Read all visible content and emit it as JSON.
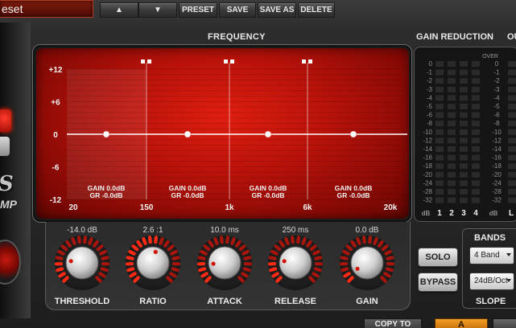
{
  "toolbar": {
    "preset_name": "eset",
    "up_arrow": "▲",
    "down_arrow": "▼",
    "preset_label": "PRESET",
    "save_label": "SAVE",
    "save_as_label": "SAVE AS",
    "delete_label": "DELETE"
  },
  "logo": {
    "letters": "S",
    "sub": "MP"
  },
  "frequency": {
    "title": "FREQUENCY",
    "y_ticks": [
      "+12",
      "+6",
      "0",
      "-6",
      "-12"
    ],
    "x_ticks": [
      "20",
      "150",
      "1k",
      "6k",
      "20k"
    ],
    "bands": [
      {
        "gain_label": "GAIN 0.0dB",
        "gr_label": "GR -0.0dB"
      },
      {
        "gain_label": "GAIN 0.0dB",
        "gr_label": "GR -0.0dB"
      },
      {
        "gain_label": "GAIN 0.0dB",
        "gr_label": "GR -0.0dB"
      },
      {
        "gain_label": "GAIN 0.0dB",
        "gr_label": "GR -0.0dB"
      }
    ]
  },
  "gain_reduction": {
    "title": "GAIN REDUCTION",
    "out_title": "OU",
    "over_label": "OVER",
    "scale": [
      "0",
      "-1",
      "-2",
      "-3",
      "-4",
      "-5",
      "-6",
      "-8",
      "-10",
      "-12",
      "-14",
      "-16",
      "-18",
      "-20",
      "-24",
      "-28",
      "-32"
    ],
    "channels": [
      "dB",
      "1",
      "2",
      "3",
      "4",
      "dB",
      "L"
    ]
  },
  "knobs": [
    {
      "value": "-14.0 dB",
      "label": "THRESHOLD",
      "level": 0.2
    },
    {
      "value": "2.6 :1",
      "label": "RATIO",
      "level": 0.55
    },
    {
      "value": "10.0 ms",
      "label": "ATTACK",
      "level": 0.15
    },
    {
      "value": "250 ms",
      "label": "RELEASE",
      "level": 0.2
    },
    {
      "value": "0.0 dB",
      "label": "GAIN",
      "level": 0.05
    }
  ],
  "controls": {
    "solo_label": "SOLO",
    "bypass_label": "BYPASS",
    "bands_title": "BANDS",
    "bands_value": "4 Band",
    "slope_title": "SLOPE",
    "slope_value": "24dB/Oct",
    "copy_to_label": "COPY TO",
    "a_label": "A"
  },
  "colors": {
    "display_red": "#c8140a",
    "knob_red": "#d4140a",
    "accent_orange": "#e08a18"
  }
}
